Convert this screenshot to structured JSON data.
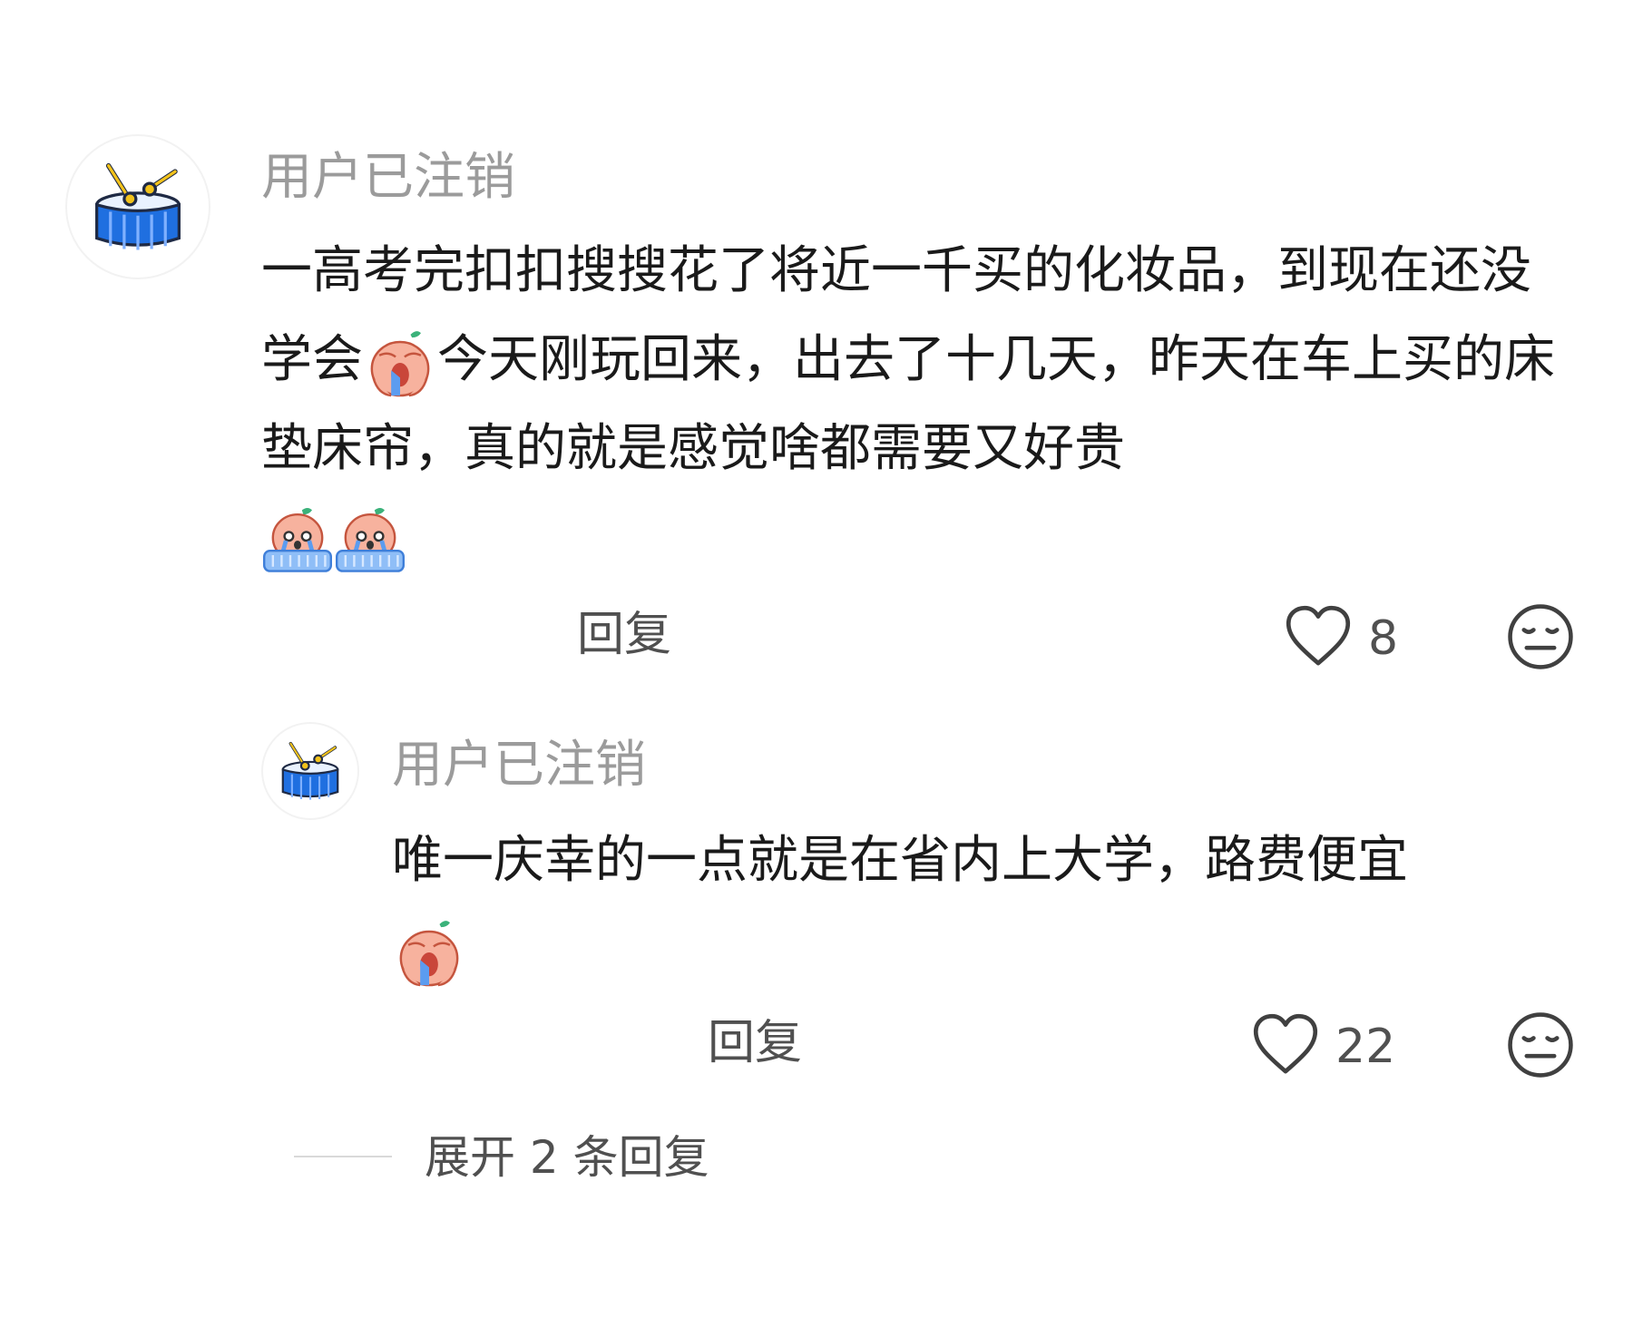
{
  "comment": {
    "username": "用户已注销",
    "avatar_icon": "drum-icon",
    "text_parts": [
      "一高考完扣扣搜搜花了将近一千买的化妆品，到现在还没学会",
      "今天刚玩回来，出去了十几天，昨天在车上买的床垫床帘，真的就是感觉啥都需要又好贵"
    ],
    "emojis": [
      "crying-emoji",
      "sobbing-emoji",
      "sobbing-emoji"
    ],
    "reply_label": "回复",
    "like_count": "8",
    "like_icon": "heart-outline-icon",
    "dislike_icon": "unamused-face-icon"
  },
  "reply": {
    "username": "用户已注销",
    "avatar_icon": "drum-icon",
    "text": "唯一庆幸的一点就是在省内上大学，路费便宜",
    "emojis": [
      "crying-emoji"
    ],
    "reply_label": "回复",
    "like_count": "22",
    "like_icon": "heart-outline-icon",
    "dislike_icon": "unamused-face-icon"
  },
  "expand": {
    "label": "展开 2 条回复"
  },
  "colors": {
    "username": "#9b9b9b",
    "text": "#1a1a1a",
    "meta": "#505050",
    "drum_blue": "#1f6fe0",
    "drum_yellow": "#f2c21b",
    "emoji_peach": "#f59a84",
    "tear_blue": "#5b9cf0"
  }
}
